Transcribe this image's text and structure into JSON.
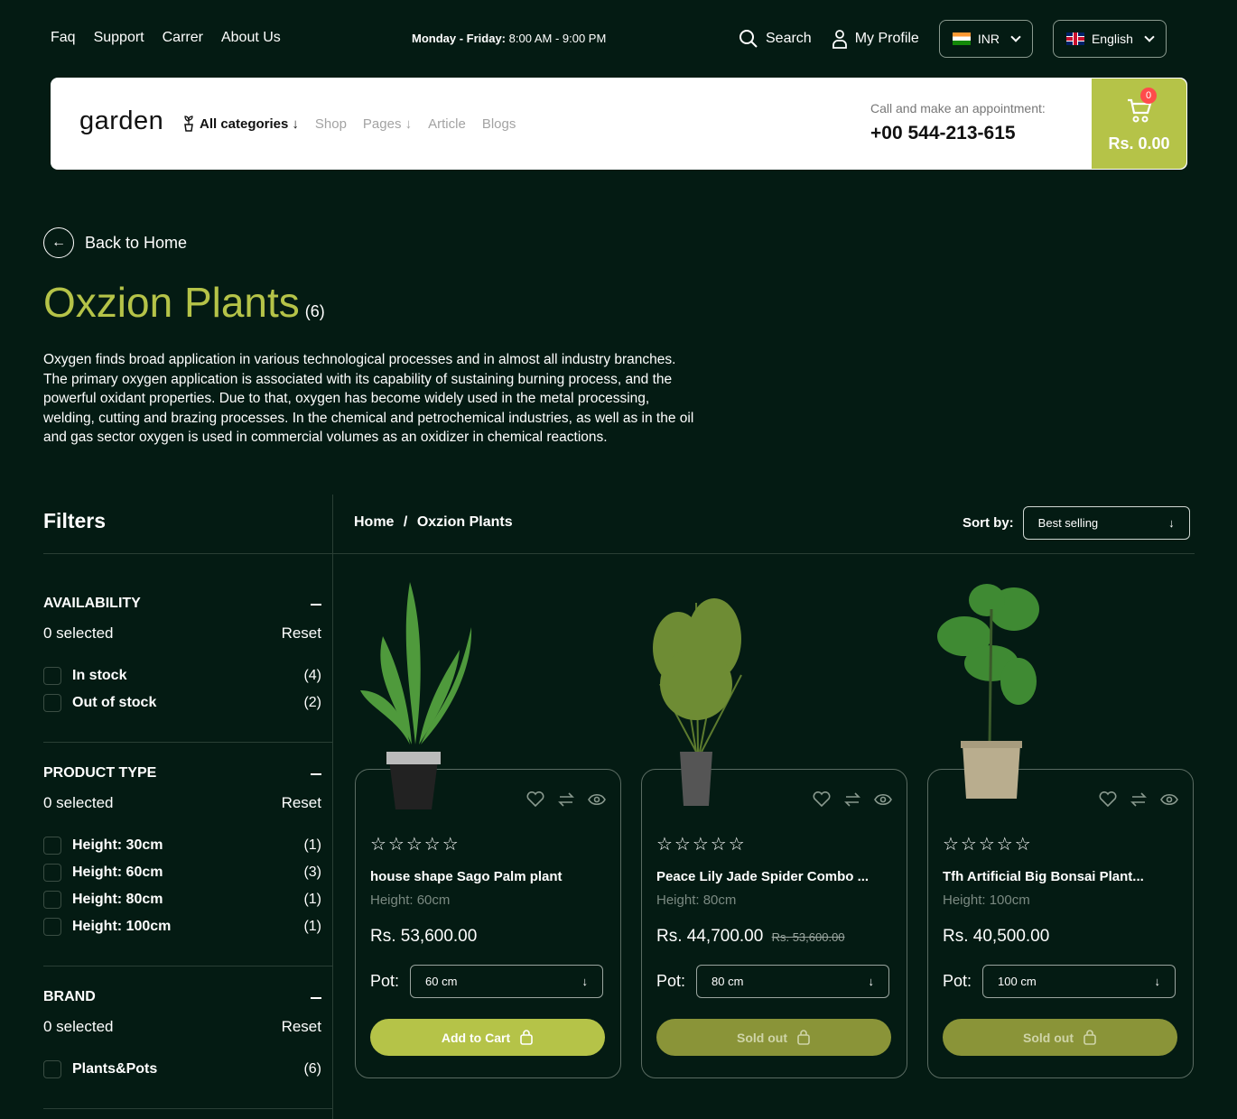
{
  "topbar": {
    "links": [
      "Faq",
      "Support",
      "Carrer",
      "About Us"
    ],
    "hours_label": "Monday - Friday:",
    "hours_value": "8:00 AM - 9:00 PM",
    "search_label": "Search",
    "profile_label": "My Profile",
    "currency": "INR",
    "language": "English"
  },
  "nav": {
    "logo": "garden",
    "categories": "All categories",
    "items": [
      "Shop",
      "Pages",
      "Article",
      "Blogs"
    ],
    "call_label": "Call and make an appointment:",
    "phone": "+00 544-213-615",
    "cart_count": "0",
    "cart_amount": "Rs. 0.00"
  },
  "page": {
    "back": "Back to Home",
    "title": "Oxzion Plants",
    "count": "(6)",
    "description": "Oxygen finds broad application in various technological processes and in almost all industry branches. The primary oxygen application is associated with its capability of sustaining burning process, and the powerful oxidant properties. Due to that, oxygen has become widely used in the metal processing, welding, cutting and brazing processes. In the chemical and petrochemical industries, as well as in the oil and gas sector oxygen is used in commercial volumes as an oxidizer in chemical reactions."
  },
  "filters": {
    "heading": "Filters",
    "groups": [
      {
        "title": "AVAILABILITY",
        "selected": "0 selected",
        "reset": "Reset",
        "options": [
          {
            "label": "In stock",
            "count": "(4)"
          },
          {
            "label": "Out of stock",
            "count": "(2)"
          }
        ]
      },
      {
        "title": "PRODUCT TYPE",
        "selected": "0 selected",
        "reset": "Reset",
        "options": [
          {
            "label": "Height: 30cm",
            "count": "(1)"
          },
          {
            "label": "Height: 60cm",
            "count": "(3)"
          },
          {
            "label": "Height: 80cm",
            "count": "(1)"
          },
          {
            "label": "Height: 100cm",
            "count": "(1)"
          }
        ]
      },
      {
        "title": "BRAND",
        "selected": "0 selected",
        "reset": "Reset",
        "options": [
          {
            "label": "Plants&Pots",
            "count": "(6)"
          }
        ]
      }
    ]
  },
  "listing": {
    "breadcrumb_home": "Home",
    "breadcrumb_sep": "/",
    "breadcrumb_current": "Oxzion Plants",
    "sort_label": "Sort by:",
    "sort_value": "Best selling",
    "products": [
      {
        "name": "house shape Sago Palm plant",
        "height": "Height: 60cm",
        "price": "Rs. 53,600.00",
        "old_price": "",
        "pot_label": "Pot:",
        "pot": "60 cm",
        "button": "Add to Cart",
        "stars": "☆☆☆☆☆"
      },
      {
        "name": "Peace Lily Jade Spider Combo ...",
        "height": "Height: 80cm",
        "price": "Rs. 44,700.00",
        "old_price": "Rs. 53,600.00",
        "pot_label": "Pot:",
        "pot": "80 cm",
        "button": "Sold out",
        "stars": "☆☆☆☆☆"
      },
      {
        "name": "Tfh Artificial Big Bonsai Plant...",
        "height": "Height: 100cm",
        "price": "Rs. 40,500.00",
        "old_price": "",
        "pot_label": "Pot:",
        "pot": "100 cm",
        "button": "Sold out",
        "stars": "☆☆☆☆☆"
      }
    ]
  },
  "colors": {
    "accent": "#b5c348",
    "background": "#041b13",
    "badge": "#ff4b4b"
  }
}
